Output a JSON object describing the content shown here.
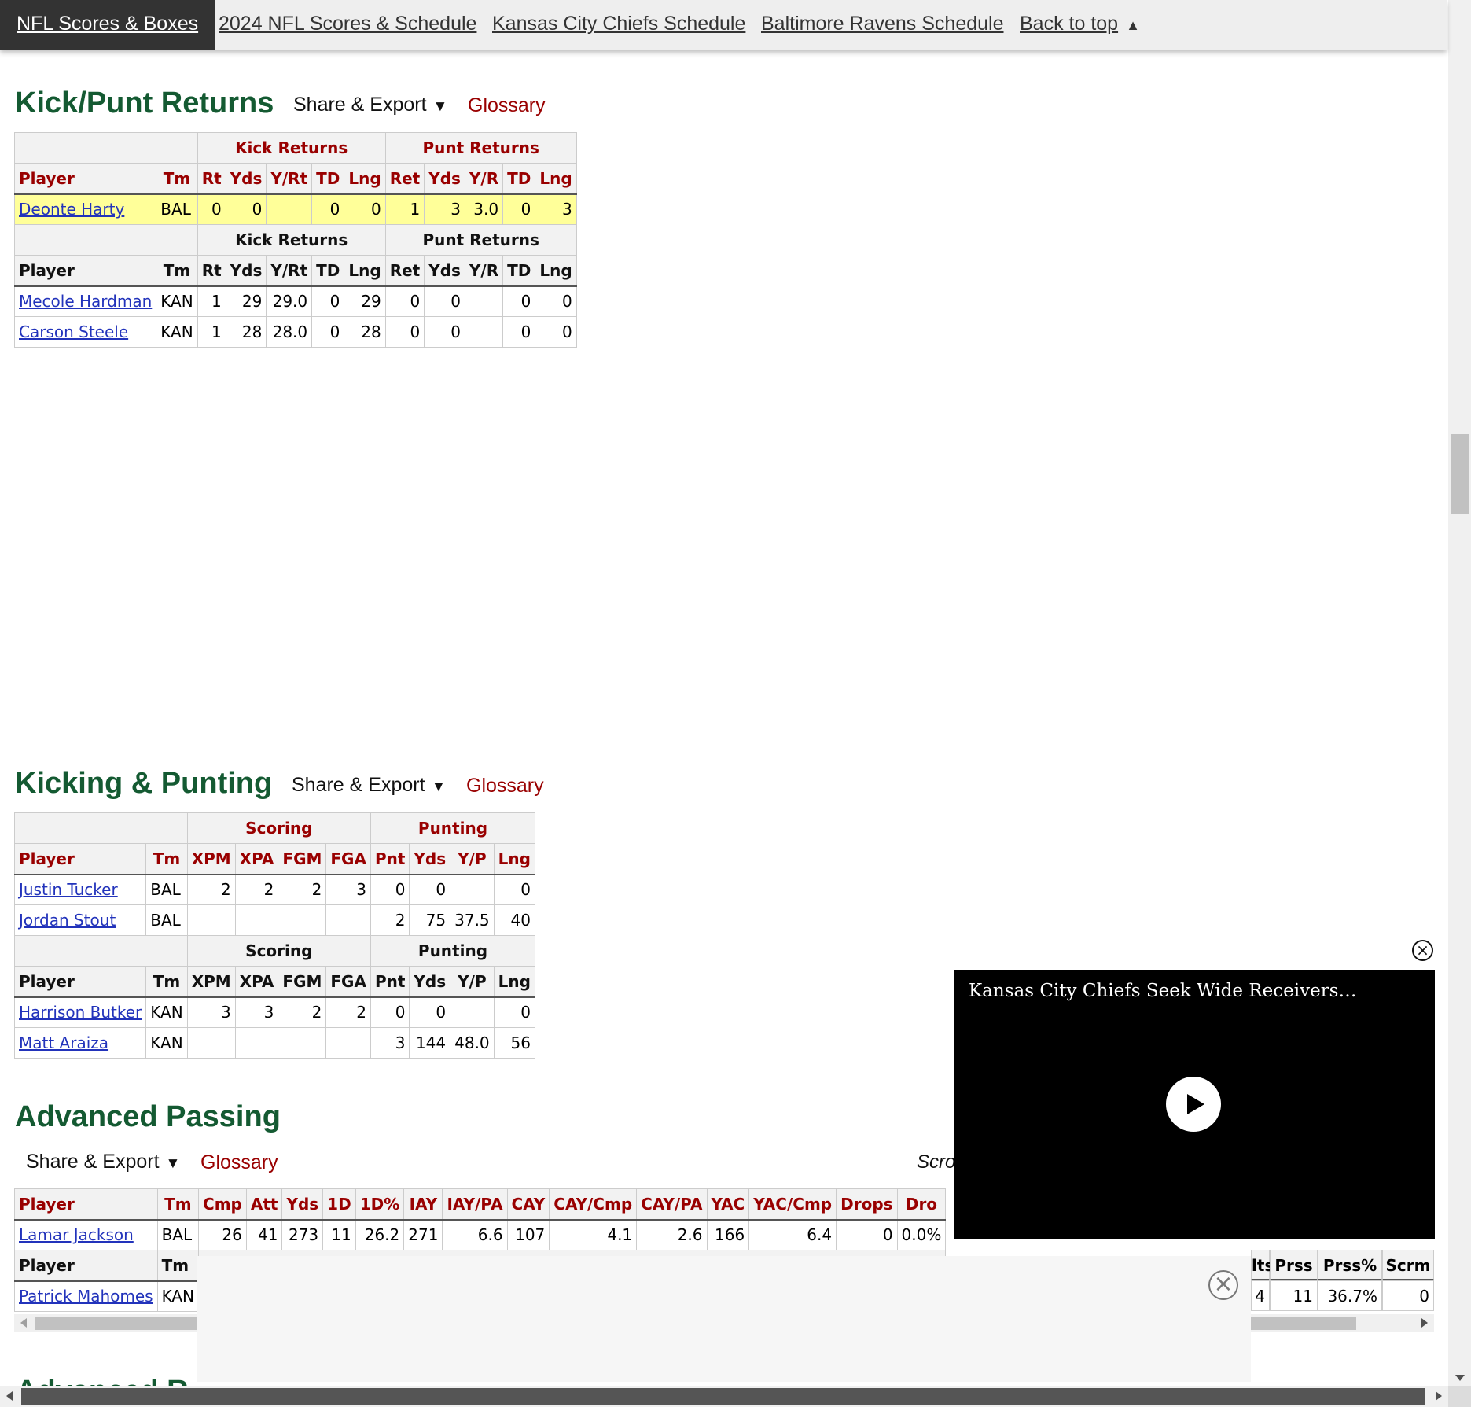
{
  "nav": {
    "items": [
      "NFL Scores & Boxes",
      "2024 NFL Scores & Schedule",
      "Kansas City Chiefs Schedule",
      "Baltimore Ravens Schedule",
      "Back to top"
    ],
    "back_arrow": "▲"
  },
  "common": {
    "share": "Share & Export",
    "caret": "▼",
    "glossary": "Glossary"
  },
  "returns": {
    "title": "Kick/Punt Returns",
    "groups": [
      "Kick Returns",
      "Punt Returns"
    ],
    "columns": [
      "Player",
      "Tm",
      "Rt",
      "Yds",
      "Y/Rt",
      "TD",
      "Lng",
      "Ret",
      "Yds",
      "Y/R",
      "TD",
      "Lng"
    ],
    "teams": [
      {
        "rows": [
          [
            "Deonte Harty",
            "BAL",
            "0",
            "0",
            "",
            "0",
            "0",
            "1",
            "3",
            "3.0",
            "0",
            "3"
          ]
        ]
      },
      {
        "rows": [
          [
            "Mecole Hardman",
            "KAN",
            "1",
            "29",
            "29.0",
            "0",
            "29",
            "0",
            "0",
            "",
            "0",
            "0"
          ],
          [
            "Carson Steele",
            "KAN",
            "1",
            "28",
            "28.0",
            "0",
            "28",
            "0",
            "0",
            "",
            "0",
            "0"
          ]
        ]
      }
    ]
  },
  "kicking": {
    "title": "Kicking & Punting",
    "groups": [
      "Scoring",
      "Punting"
    ],
    "columns": [
      "Player",
      "Tm",
      "XPM",
      "XPA",
      "FGM",
      "FGA",
      "Pnt",
      "Yds",
      "Y/P",
      "Lng"
    ],
    "teams": [
      {
        "rows": [
          [
            "Justin Tucker",
            "BAL",
            "2",
            "2",
            "2",
            "3",
            "0",
            "0",
            "",
            "0"
          ],
          [
            "Jordan Stout",
            "BAL",
            "",
            "",
            "",
            "",
            "2",
            "75",
            "37.5",
            "40"
          ]
        ]
      },
      {
        "rows": [
          [
            "Harrison Butker",
            "KAN",
            "3",
            "3",
            "2",
            "2",
            "0",
            "0",
            "",
            "0"
          ],
          [
            "Matt Araiza",
            "KAN",
            "",
            "",
            "",
            "",
            "3",
            "144",
            "48.0",
            "56"
          ]
        ]
      }
    ]
  },
  "adv_passing": {
    "title": "Advanced Passing",
    "scroll_hint": "Scro",
    "columns": [
      "Player",
      "Tm",
      "Cmp",
      "Att",
      "Yds",
      "1D",
      "1D%",
      "IAY",
      "IAY/PA",
      "CAY",
      "CAY/Cmp",
      "CAY/PA",
      "YAC",
      "YAC/Cmp",
      "Drops",
      "Dro"
    ],
    "row1": [
      "Lamar Jackson",
      "BAL",
      "26",
      "41",
      "273",
      "11",
      "26.2",
      "271",
      "6.6",
      "107",
      "4.1",
      "2.6",
      "166",
      "6.4",
      "0",
      "0.0%"
    ],
    "row2_player": "Patrick Mahomes",
    "row2_team": "KAN",
    "row2_visible_headers": [
      "Player",
      "Tm",
      "lts",
      "Prss",
      "Prss%",
      "Scrm"
    ],
    "row2_visible_values": [
      "4",
      "11",
      "36.7%",
      "0"
    ]
  },
  "video": {
    "title": "Kansas City Chiefs Seek Wide Receivers…"
  },
  "next_section_peek": "Advanced R"
}
